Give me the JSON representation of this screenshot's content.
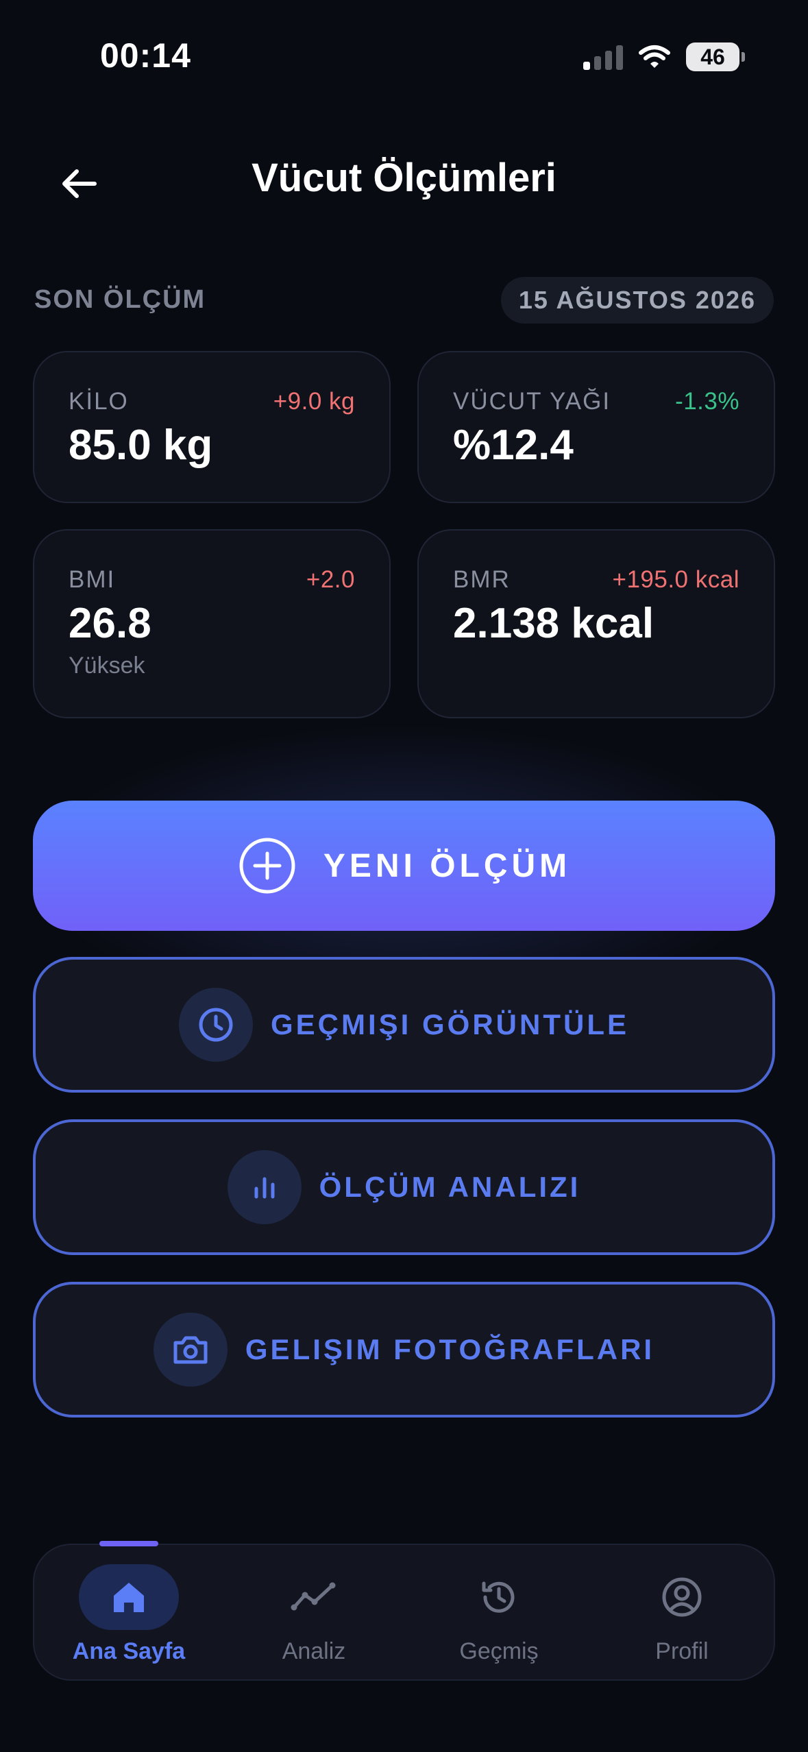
{
  "status_bar": {
    "time": "00:14",
    "battery": "46"
  },
  "header": {
    "title": "Vücut Ölçümleri",
    "back_icon": "arrow-left-icon"
  },
  "section": {
    "label": "SON ÖLÇÜM",
    "date": "15 AĞUSTOS 2026"
  },
  "metrics": [
    {
      "label": "KİLO",
      "value": "85.0 kg",
      "delta": "+9.0 kg",
      "delta_trend": "up",
      "sub": ""
    },
    {
      "label": "VÜCUT YAĞI",
      "value": "%12.4",
      "delta": "-1.3%",
      "delta_trend": "down",
      "sub": ""
    },
    {
      "label": "BMI",
      "value": "26.8",
      "delta": "+2.0",
      "delta_trend": "up",
      "sub": "Yüksek"
    },
    {
      "label": "BMR",
      "value": "2.138 kcal",
      "delta": "+195.0 kcal",
      "delta_trend": "up",
      "sub": ""
    }
  ],
  "actions": {
    "primary": {
      "label": "YENI ÖLÇÜM",
      "icon": "plus-circle-icon"
    },
    "history": {
      "label": "GEÇMIŞI GÖRÜNTÜLE",
      "icon": "clock-icon"
    },
    "analysis": {
      "label": "ÖLÇÜM ANALIZI",
      "icon": "bar-chart-icon"
    },
    "photos": {
      "label": "GELIŞIM FOTOĞRAFLARI",
      "icon": "camera-icon"
    }
  },
  "bottom_nav": [
    {
      "label": "Ana Sayfa",
      "icon": "home-icon",
      "active": true
    },
    {
      "label": "Analiz",
      "icon": "trend-line-icon",
      "active": false
    },
    {
      "label": "Geçmiş",
      "icon": "history-icon",
      "active": false
    },
    {
      "label": "Profil",
      "icon": "user-circle-icon",
      "active": false
    }
  ],
  "colors": {
    "background": "#090b12",
    "card": "#0f121b",
    "accent": "#5b7bf0",
    "gradient_start": "#5a82ff",
    "gradient_end": "#7161f8",
    "delta_up": "#f07272",
    "delta_down": "#39c28a"
  }
}
